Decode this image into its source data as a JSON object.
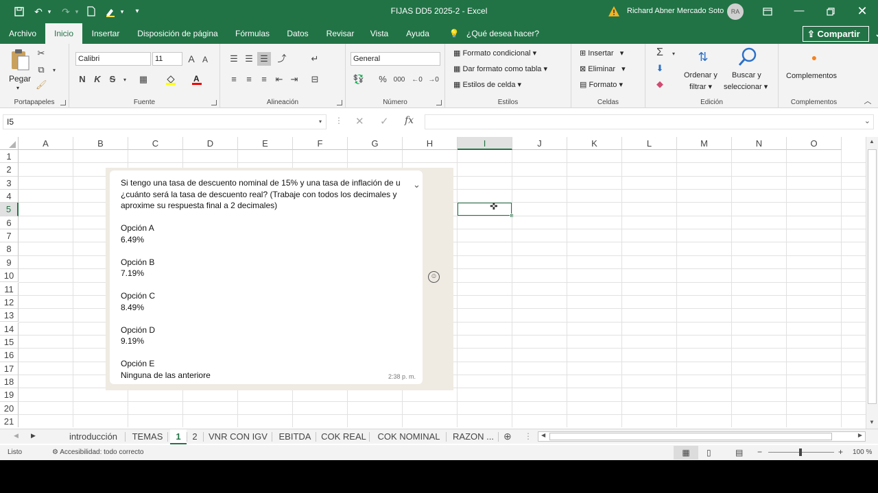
{
  "window": {
    "title": "FIJAS DD5 2025-2  -  Excel",
    "user_name": "Richard Abner Mercado Soto",
    "user_initials": "RA"
  },
  "menu": {
    "tabs": [
      "Archivo",
      "Inicio",
      "Insertar",
      "Disposición de página",
      "Fórmulas",
      "Datos",
      "Revisar",
      "Vista",
      "Ayuda"
    ],
    "search_placeholder": "¿Qué desea hacer?",
    "share_label": "Compartir"
  },
  "ribbon": {
    "portapapeles": {
      "paste_label": "Pegar",
      "group_label": "Portapapeles"
    },
    "fuente": {
      "font_name": "Calibri",
      "font_size": "11",
      "bold": "N",
      "italic": "K",
      "strike": "S",
      "group_label": "Fuente"
    },
    "alineacion": {
      "group_label": "Alineación"
    },
    "numero": {
      "format": "General",
      "group_label": "Número"
    },
    "estilos": {
      "cond_format": "Formato condicional",
      "table_format": "Dar formato como tabla",
      "cell_styles": "Estilos de celda",
      "group_label": "Estilos"
    },
    "celdas": {
      "insert": "Insertar",
      "delete": "Eliminar",
      "format": "Formato",
      "group_label": "Celdas"
    },
    "edicion": {
      "sort_filter_1": "Ordenar y",
      "sort_filter_2": "filtrar",
      "find_select_1": "Buscar y",
      "find_select_2": "seleccionar",
      "group_label": "Edición"
    },
    "complementos": {
      "addins": "Complementos",
      "group_label": "Complementos"
    }
  },
  "formula_bar": {
    "name_box": "I5",
    "fx": "fx",
    "formula": ""
  },
  "grid": {
    "columns": [
      "A",
      "B",
      "C",
      "D",
      "E",
      "F",
      "G",
      "H",
      "I",
      "J",
      "K",
      "L",
      "M",
      "N",
      "O"
    ],
    "rows": [
      "1",
      "2",
      "3",
      "4",
      "5",
      "6",
      "7",
      "8",
      "9",
      "10",
      "11",
      "12",
      "13",
      "14",
      "15",
      "16",
      "17",
      "18",
      "19",
      "20",
      "21"
    ],
    "selected_column": "I",
    "selected_row": "5"
  },
  "chat": {
    "question_line1": "Si tengo una tasa de descuento nominal de 15% y una tasa de inflación de u",
    "question_line2": "¿cuánto será la tasa de descuento real? (Trabaje con todos los decimales y",
    "question_line3": "aproxime su respuesta final a 2 decimales)",
    "options": [
      {
        "label": "Opción A",
        "value": "6.49%"
      },
      {
        "label": "Opción B",
        "value": "7.19%"
      },
      {
        "label": "Opción C",
        "value": "8.49%"
      },
      {
        "label": "Opción D",
        "value": "9.19%"
      },
      {
        "label": "Opción E",
        "value": "Ninguna de las anteriore"
      }
    ],
    "time": "2:38 p. m."
  },
  "sheets": {
    "tabs": [
      "introducción",
      "TEMAS",
      "1",
      "2",
      "VNR CON IGV",
      "EBITDA",
      "COK REAL",
      "COK NOMINAL",
      "RAZON ..."
    ],
    "active": "1"
  },
  "status": {
    "ready": "Listo",
    "accessibility": "Accesibilidad: todo correcto",
    "zoom": "100 %"
  },
  "colors": {
    "excel_green": "#217346",
    "ribbon_bg": "#f3f3f3",
    "chat_bg": "#efeae2"
  }
}
